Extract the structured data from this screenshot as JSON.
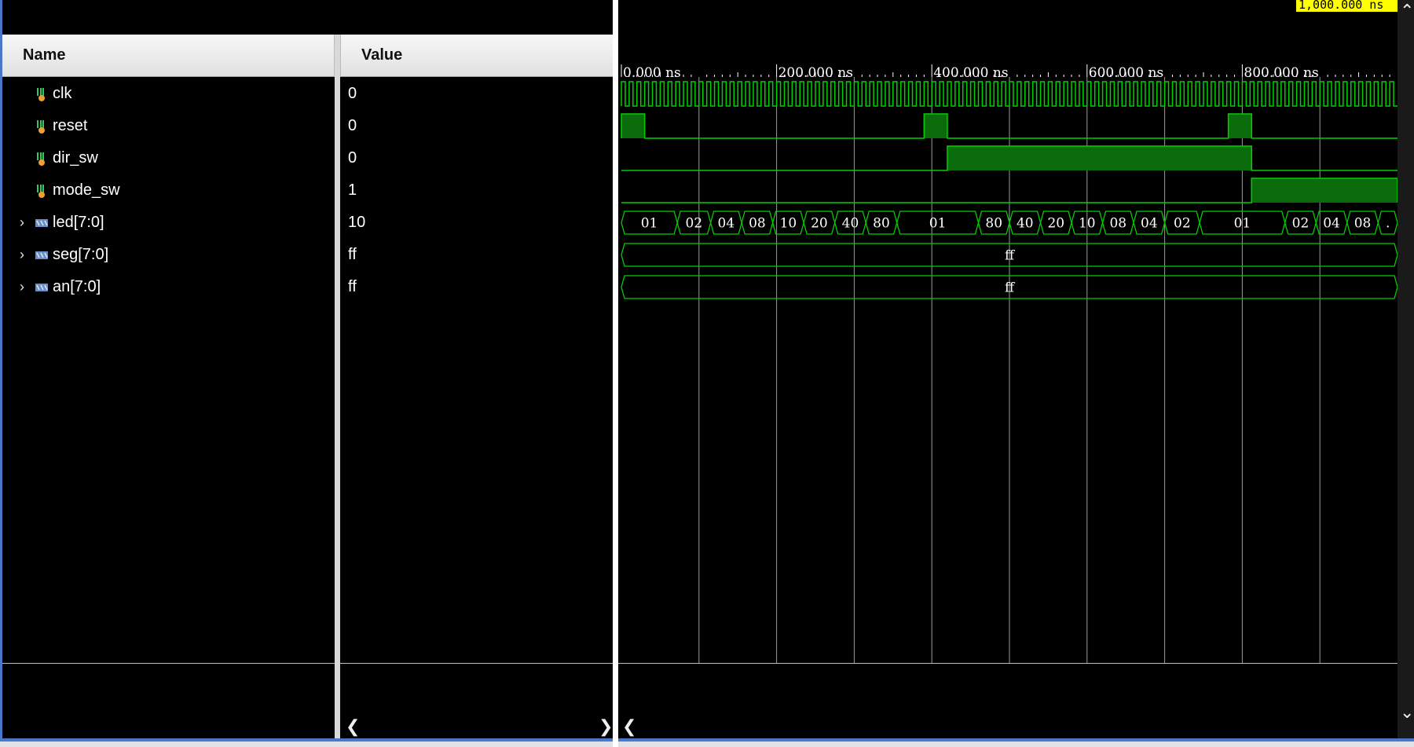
{
  "columns": {
    "name": "Name",
    "value": "Value"
  },
  "signals": [
    {
      "name": "clk",
      "value": "0",
      "kind": "bit",
      "expandable": false
    },
    {
      "name": "reset",
      "value": "0",
      "kind": "bit",
      "expandable": false
    },
    {
      "name": "dir_sw",
      "value": "0",
      "kind": "bit",
      "expandable": false
    },
    {
      "name": "mode_sw",
      "value": "1",
      "kind": "bit",
      "expandable": false
    },
    {
      "name": "led[7:0]",
      "value": "10",
      "kind": "bus",
      "expandable": true
    },
    {
      "name": "seg[7:0]",
      "value": "ff",
      "kind": "bus",
      "expandable": true
    },
    {
      "name": "an[7:0]",
      "value": "ff",
      "kind": "bus",
      "expandable": true
    }
  ],
  "timeline": {
    "unit": "ns",
    "range_ns": [
      0,
      1000
    ],
    "major_ticks": [
      {
        "t": 0,
        "label": "0.000 ns"
      },
      {
        "t": 200,
        "label": "200.000 ns"
      },
      {
        "t": 400,
        "label": "400.000 ns"
      },
      {
        "t": 600,
        "label": "600.000 ns"
      },
      {
        "t": 800,
        "label": "800.000 ns"
      }
    ],
    "grid_ns": [
      100,
      200,
      300,
      400,
      500,
      600,
      700,
      800,
      900
    ],
    "cursor_label": "1,000.000 ns"
  },
  "waves": {
    "clk": {
      "period_ns": 10
    },
    "reset": {
      "high_intervals_ns": [
        [
          0,
          30
        ],
        [
          390,
          420
        ],
        [
          782,
          812
        ]
      ]
    },
    "dir_sw": {
      "high_intervals_ns": [
        [
          420,
          812
        ]
      ]
    },
    "mode_sw": {
      "high_intervals_ns": [
        [
          812,
          1000
        ]
      ]
    },
    "led": [
      {
        "start": 0,
        "end": 72,
        "label": "01"
      },
      {
        "start": 72,
        "end": 115,
        "label": "02"
      },
      {
        "start": 115,
        "end": 155,
        "label": "04"
      },
      {
        "start": 155,
        "end": 195,
        "label": "08"
      },
      {
        "start": 195,
        "end": 235,
        "label": "10"
      },
      {
        "start": 235,
        "end": 275,
        "label": "20"
      },
      {
        "start": 275,
        "end": 315,
        "label": "40"
      },
      {
        "start": 315,
        "end": 355,
        "label": "80"
      },
      {
        "start": 355,
        "end": 460,
        "label": "01"
      },
      {
        "start": 460,
        "end": 500,
        "label": "80"
      },
      {
        "start": 500,
        "end": 540,
        "label": "40"
      },
      {
        "start": 540,
        "end": 580,
        "label": "20"
      },
      {
        "start": 580,
        "end": 620,
        "label": "10"
      },
      {
        "start": 620,
        "end": 660,
        "label": "08"
      },
      {
        "start": 660,
        "end": 700,
        "label": "04"
      },
      {
        "start": 700,
        "end": 745,
        "label": "02"
      },
      {
        "start": 745,
        "end": 855,
        "label": "01"
      },
      {
        "start": 855,
        "end": 895,
        "label": "02"
      },
      {
        "start": 895,
        "end": 935,
        "label": "04"
      },
      {
        "start": 935,
        "end": 975,
        "label": "08"
      },
      {
        "start": 975,
        "end": 1000,
        "label": "."
      }
    ],
    "seg": [
      {
        "start": 0,
        "end": 1000,
        "label": "ff"
      }
    ],
    "an": [
      {
        "start": 0,
        "end": 1000,
        "label": "ff"
      }
    ]
  },
  "colors": {
    "wave": "#00d000",
    "wave_fill": "#0a6b0a",
    "grid": "#9a9a9a",
    "ruler_text": "#ffffff",
    "cursor_label_bg": "#ffff00"
  },
  "icons": {
    "bit": "single-bit-signal-icon",
    "bus": "bus-signal-icon",
    "expander": "chevron-right-icon",
    "scroll_left": "chevron-left-icon",
    "scroll_right": "chevron-right-icon",
    "scroll_up": "chevron-up-icon",
    "scroll_down": "chevron-down-icon"
  }
}
